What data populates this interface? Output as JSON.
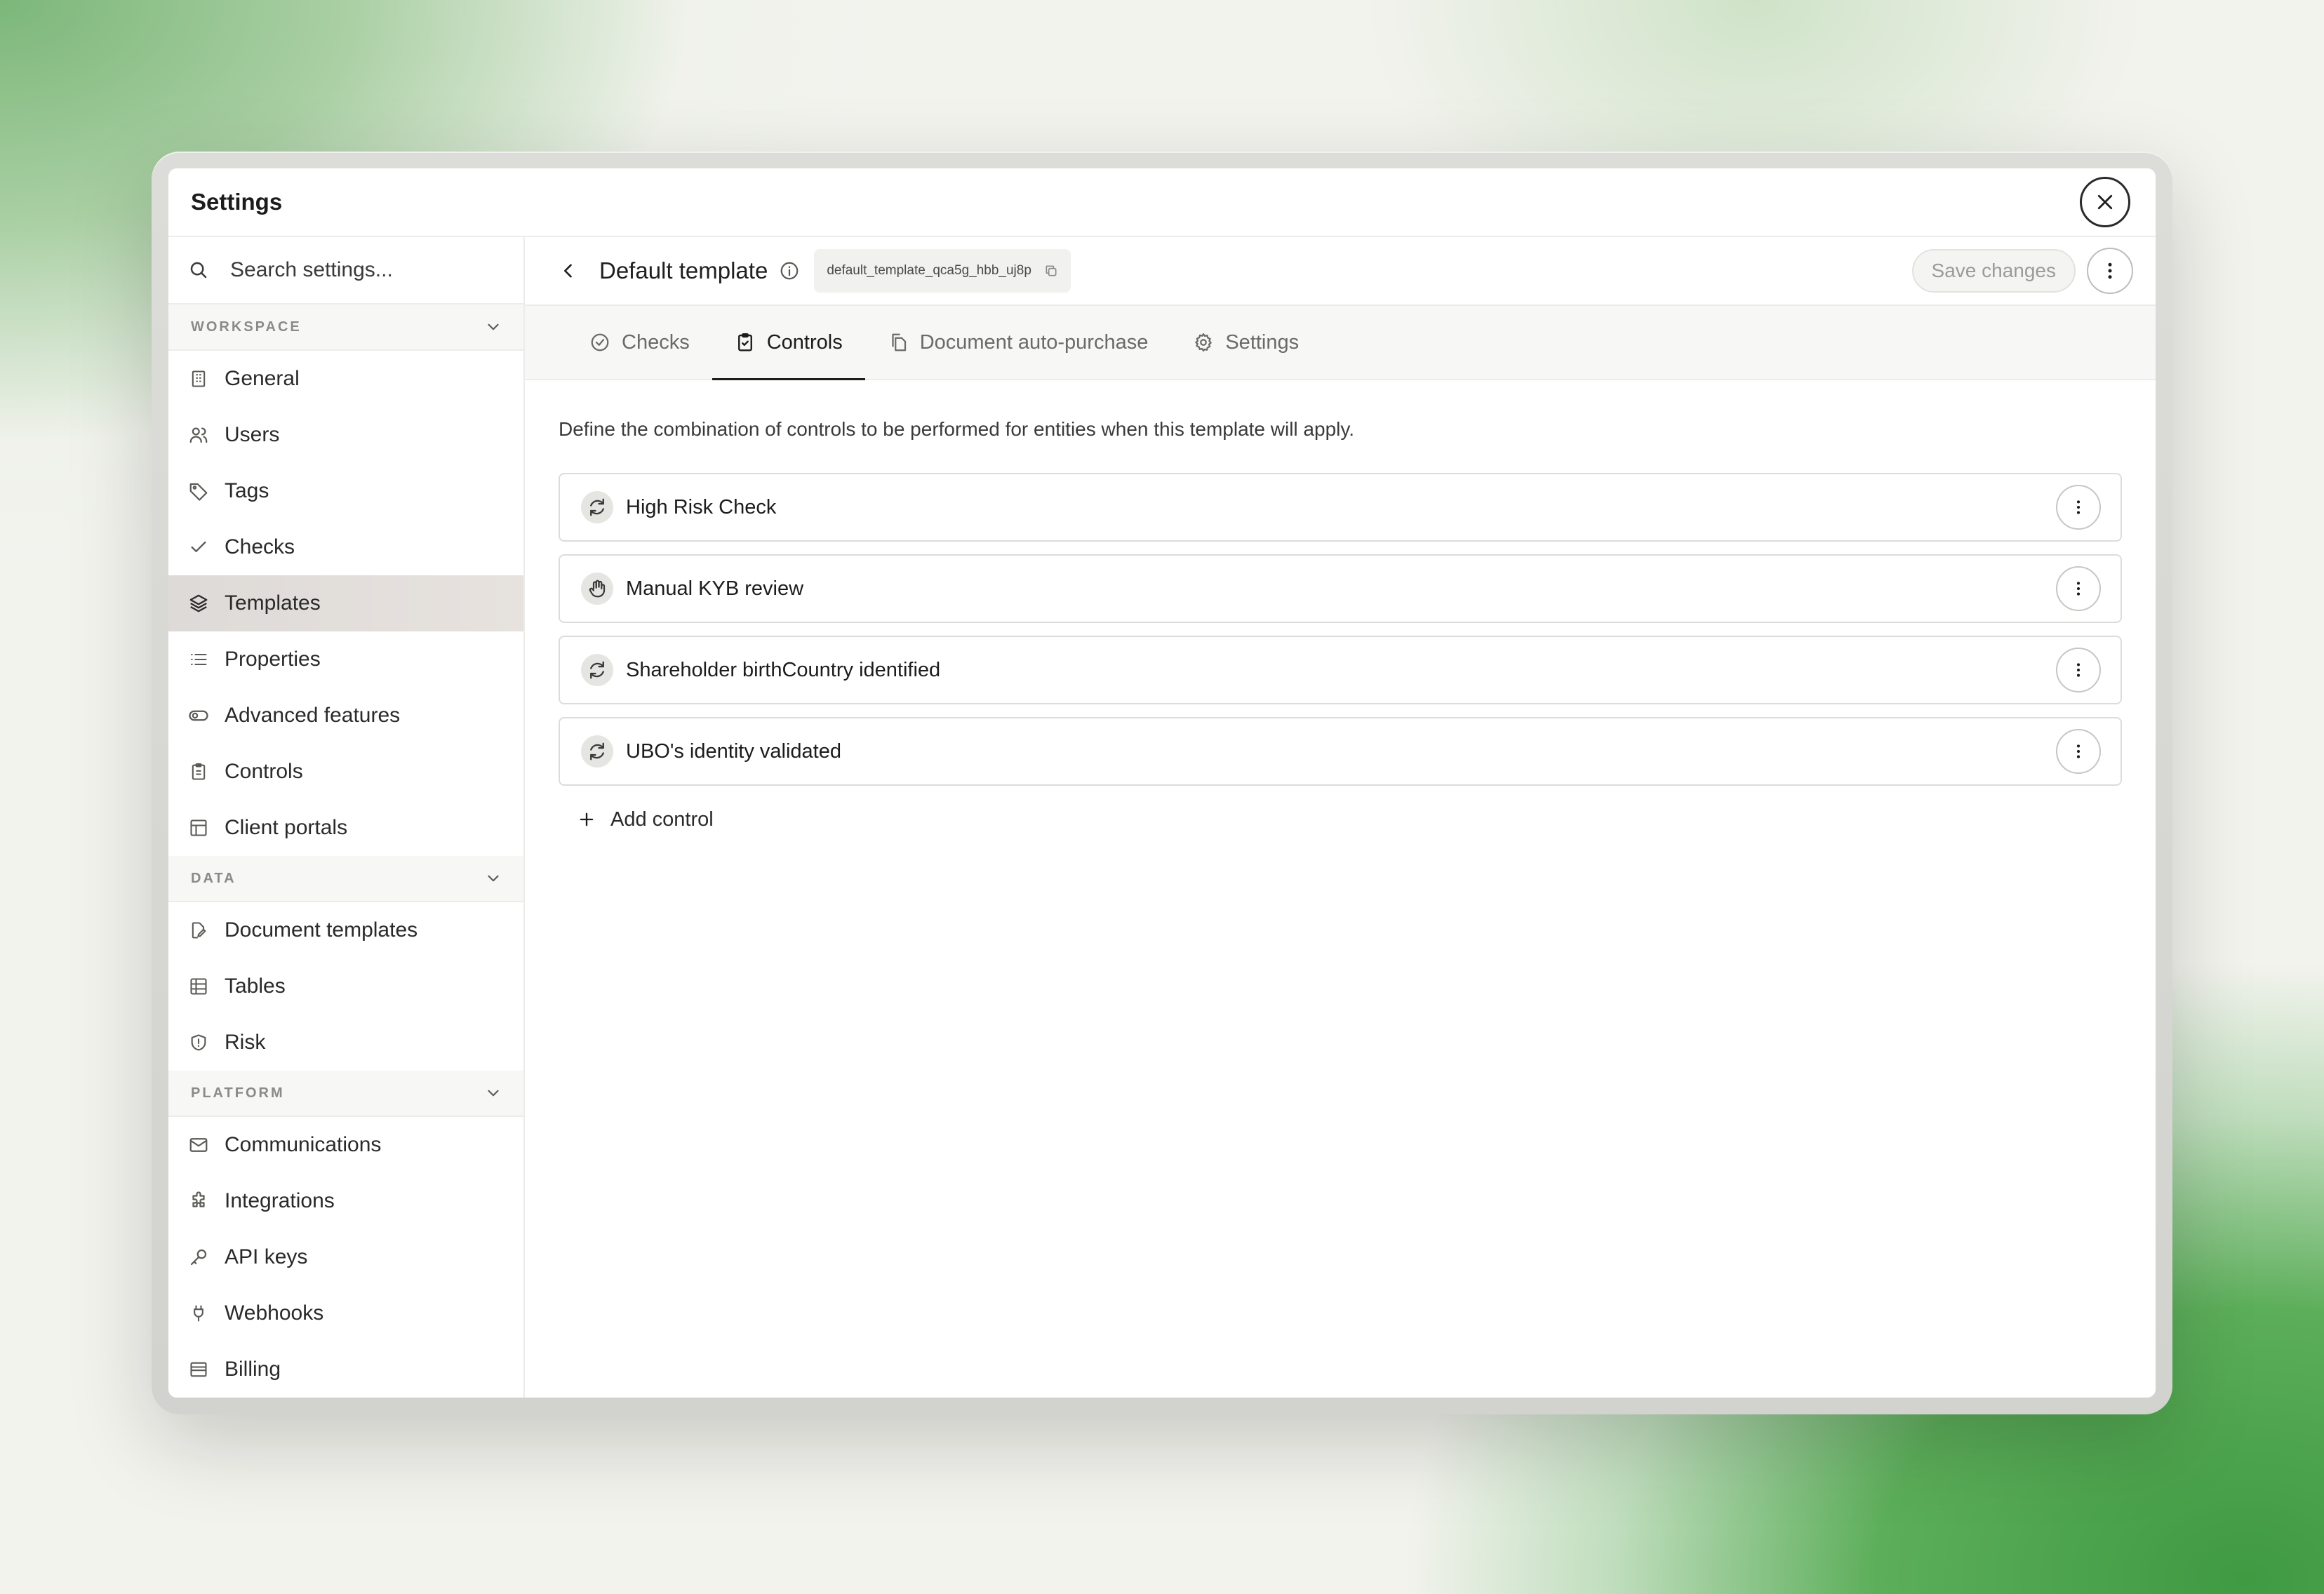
{
  "modal": {
    "title": "Settings"
  },
  "sidebar": {
    "search_placeholder": "Search settings...",
    "sections": [
      {
        "label": "WORKSPACE",
        "items": [
          {
            "label": "General",
            "icon": "building-icon"
          },
          {
            "label": "Users",
            "icon": "users-icon"
          },
          {
            "label": "Tags",
            "icon": "tag-icon"
          },
          {
            "label": "Checks",
            "icon": "check-icon"
          },
          {
            "label": "Templates",
            "icon": "layers-icon",
            "active": true
          },
          {
            "label": "Properties",
            "icon": "list-icon"
          },
          {
            "label": "Advanced features",
            "icon": "toggle-icon"
          },
          {
            "label": "Controls",
            "icon": "clipboard-icon"
          },
          {
            "label": "Client portals",
            "icon": "layout-icon"
          }
        ]
      },
      {
        "label": "DATA",
        "items": [
          {
            "label": "Document templates",
            "icon": "file-edit-icon"
          },
          {
            "label": "Tables",
            "icon": "table-icon"
          },
          {
            "label": "Risk",
            "icon": "shield-icon"
          }
        ]
      },
      {
        "label": "PLATFORM",
        "items": [
          {
            "label": "Communications",
            "icon": "mail-icon"
          },
          {
            "label": "Integrations",
            "icon": "puzzle-icon"
          },
          {
            "label": "API keys",
            "icon": "key-icon"
          },
          {
            "label": "Webhooks",
            "icon": "plug-icon"
          },
          {
            "label": "Billing",
            "icon": "wallet-icon"
          }
        ]
      }
    ]
  },
  "header": {
    "title": "Default template",
    "slug": "default_template_qca5g_hbb_uj8p",
    "save_label": "Save changes"
  },
  "tabs": [
    {
      "label": "Checks",
      "icon": "check-circle-icon"
    },
    {
      "label": "Controls",
      "icon": "clipboard-check-icon",
      "active": true
    },
    {
      "label": "Document auto-purchase",
      "icon": "files-icon"
    },
    {
      "label": "Settings",
      "icon": "gear-icon"
    }
  ],
  "content": {
    "description": "Define the combination of controls to be performed for entities when this template will apply.",
    "controls": [
      {
        "label": "High Risk Check",
        "icon": "refresh-icon"
      },
      {
        "label": "Manual KYB review",
        "icon": "hand-icon"
      },
      {
        "label": "Shareholder birthCountry identified",
        "icon": "refresh-icon"
      },
      {
        "label": "UBO's identity validated",
        "icon": "refresh-icon"
      }
    ],
    "add_label": "Add control"
  }
}
